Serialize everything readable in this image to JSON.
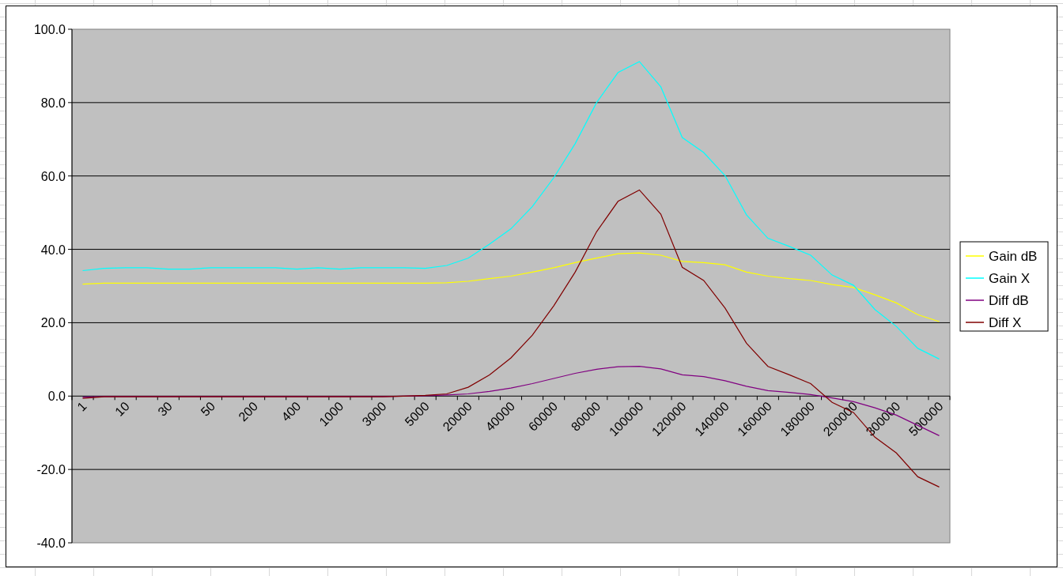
{
  "chart": {
    "chart_data": {
      "type": "line",
      "categories": [
        "1",
        null,
        "10",
        null,
        "30",
        null,
        "50",
        null,
        "200",
        null,
        "400",
        null,
        "1000",
        null,
        "3000",
        null,
        "5000",
        null,
        "20000",
        null,
        "40000",
        null,
        "60000",
        null,
        "80000",
        null,
        "100000",
        null,
        "120000",
        null,
        "140000",
        null,
        "160000",
        null,
        "180000",
        null,
        "200000",
        null,
        "300000",
        null,
        "500000"
      ],
      "ylim": [
        -40,
        100
      ],
      "grid": "y",
      "legend": "right",
      "yticks": [
        {
          "value": -40,
          "label": "-40.0"
        },
        {
          "value": -20,
          "label": "-20.0"
        },
        {
          "value": 0,
          "label": "0.0"
        },
        {
          "value": 20,
          "label": "20.0"
        },
        {
          "value": 40,
          "label": "40.0"
        },
        {
          "value": 60,
          "label": "60.0"
        },
        {
          "value": 80,
          "label": "80.0"
        },
        {
          "value": 100,
          "label": "100.0"
        }
      ],
      "series": [
        {
          "name": "Gain dB",
          "color": "#ffff00",
          "values": [
            30.5,
            30.8,
            30.8,
            30.8,
            30.8,
            30.8,
            30.8,
            30.8,
            30.8,
            30.8,
            30.8,
            30.8,
            30.8,
            30.8,
            30.8,
            30.8,
            30.8,
            30.9,
            31.3,
            32.0,
            32.7,
            33.8,
            35.0,
            36.4,
            37.6,
            38.8,
            39.0,
            38.4,
            36.7,
            36.4,
            35.8,
            33.8,
            32.7,
            32.0,
            31.5,
            30.4,
            29.6,
            27.6,
            25.4,
            22.2,
            20.3
          ]
        },
        {
          "name": "Gain X",
          "color": "#00ffff",
          "values": [
            34.2,
            34.8,
            35.0,
            35.0,
            34.6,
            34.6,
            35.0,
            35.0,
            35.0,
            35.0,
            34.6,
            35.0,
            34.6,
            35.0,
            35.0,
            35.0,
            34.8,
            35.6,
            37.6,
            41.4,
            45.6,
            51.7,
            59.5,
            68.8,
            80.0,
            88.2,
            91.2,
            84.3,
            70.5,
            66.4,
            60.1,
            49.4,
            43.0,
            40.8,
            38.4,
            33.0,
            30.2,
            23.6,
            19.0,
            13.0,
            10.1
          ]
        },
        {
          "name": "Diff dB",
          "color": "#800080",
          "values": [
            -0.3,
            -0.1,
            -0.1,
            -0.1,
            -0.1,
            -0.1,
            -0.1,
            -0.1,
            -0.1,
            -0.1,
            -0.1,
            -0.1,
            -0.1,
            -0.1,
            -0.1,
            0.0,
            0.1,
            0.3,
            0.6,
            1.3,
            2.2,
            3.4,
            4.8,
            6.2,
            7.3,
            8.0,
            8.1,
            7.4,
            5.8,
            5.3,
            4.2,
            2.7,
            1.5,
            1.0,
            0.4,
            -0.5,
            -1.5,
            -3.2,
            -5.2,
            -8.0,
            -10.8
          ]
        },
        {
          "name": "Diff X",
          "color": "#800000",
          "values": [
            -0.6,
            -0.2,
            -0.2,
            -0.2,
            -0.2,
            -0.2,
            -0.2,
            -0.2,
            -0.2,
            -0.2,
            -0.2,
            -0.2,
            -0.2,
            -0.2,
            -0.2,
            0.0,
            0.2,
            0.6,
            2.4,
            5.8,
            10.4,
            16.6,
            24.6,
            33.8,
            44.8,
            53.1,
            56.2,
            49.6,
            35.1,
            31.5,
            24.0,
            14.4,
            8.1,
            5.8,
            3.4,
            -1.7,
            -4.5,
            -11.2,
            -15.5,
            -22.0,
            -24.8
          ]
        }
      ]
    }
  }
}
